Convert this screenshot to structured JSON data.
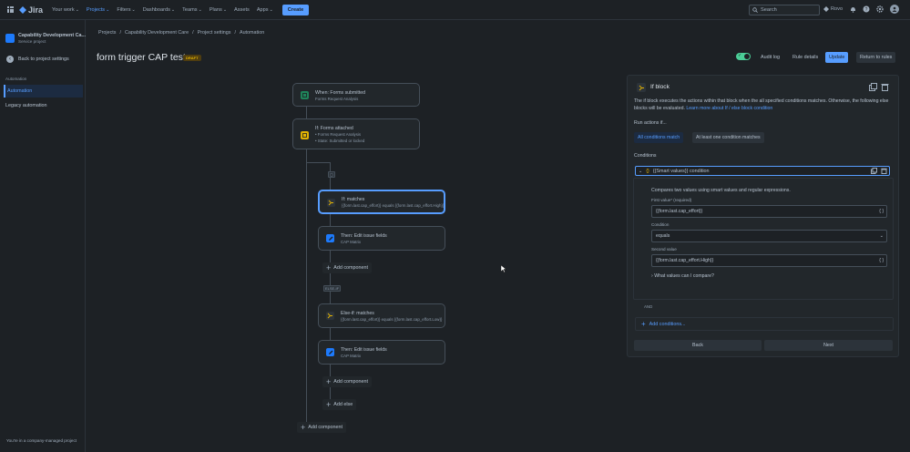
{
  "topbar": {
    "logo": "Jira",
    "nav": [
      {
        "label": "Your work",
        "chevron": true,
        "active": false
      },
      {
        "label": "Projects",
        "chevron": true,
        "active": true
      },
      {
        "label": "Filters",
        "chevron": true,
        "active": false
      },
      {
        "label": "Dashboards",
        "chevron": true,
        "active": false
      },
      {
        "label": "Teams",
        "chevron": true,
        "active": false
      },
      {
        "label": "Plans",
        "chevron": true,
        "active": false
      },
      {
        "label": "Assets",
        "chevron": false,
        "active": false
      },
      {
        "label": "Apps",
        "chevron": true,
        "active": false
      }
    ],
    "create_label": "Create",
    "search_placeholder": "Search",
    "rovo_label": "Rovo",
    "icons": [
      "bell-icon",
      "help-icon",
      "settings-icon"
    ]
  },
  "sidebar": {
    "project_name": "Capability Development Ca...",
    "project_type": "Service project",
    "back_label": "Back to project settings",
    "section_label": "Automation",
    "items": [
      {
        "label": "Automation",
        "active": true
      },
      {
        "label": "Legacy automation",
        "active": false
      }
    ],
    "footer": "You're in a company-managed project"
  },
  "breadcrumb": [
    "Projects",
    "/",
    "Capability Development Care",
    "/",
    "Project settings",
    "/",
    "Automation"
  ],
  "header": {
    "title": "form trigger CAP test",
    "badge": "DRAFT",
    "enabled": true,
    "buttons": {
      "audit": "Audit log",
      "details": "Rule details",
      "update": "Update",
      "return": "Return to rules"
    }
  },
  "flow": {
    "trigger": {
      "title": "When: Forms submitted",
      "sub": "Forms Request Analysis"
    },
    "if_forms": {
      "title": "If: Forms attached",
      "items": [
        "Forms Request Analysis",
        "State: Submitted or locked"
      ]
    },
    "if_matches": {
      "title": "If: matches",
      "sub": "{{form.last.cap_effort}} equals {{form.last.cap_effort.High}}"
    },
    "then1": {
      "title": "Then: Edit issue fields",
      "sub": "CAP Matrix"
    },
    "add_component_1": "Add component",
    "else_tag": "ELSE-IF",
    "else_if": {
      "title": "Else-if: matches",
      "sub": "{{form.last.cap_effort}} equals {{form.last.cap_effort.Low}}"
    },
    "then2": {
      "title": "Then: Edit issue fields",
      "sub": "CAP Matrix"
    },
    "add_component_2": "Add component",
    "add_else": "Add else",
    "add_component_3": "Add component"
  },
  "panel": {
    "title": "If block",
    "desc_pre": "The if block executes the actions within that block when the all specified conditions matches. Otherwise, the following else blocks will be evaluated.",
    "desc_link": "Learn more about If / else block condition",
    "run_label": "Run actions if...",
    "seg_all": "All conditions match",
    "seg_any": "At least one condition matches",
    "conditions_label": "Conditions",
    "cond_title": "{{Smart values}} condition",
    "cond_desc": "Compares two values using smart values and regular expressions.",
    "first_label": "First value",
    "first_req": "* (required)",
    "first_value": "{{form.last.cap_effort}}",
    "condition_label": "Condition",
    "condition_value": "equals",
    "second_label": "Second value",
    "second_value": "{{form.last.cap_effort.High}}",
    "help": "What values can I compare?",
    "and_label": "AND",
    "add_conditions": "Add conditions...",
    "back": "Back",
    "next": "Next"
  }
}
